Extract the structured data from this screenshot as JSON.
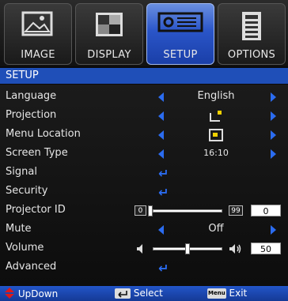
{
  "tabs": [
    {
      "label": "IMAGE",
      "icon": "picture-icon"
    },
    {
      "label": "DISPLAY",
      "icon": "display-icon"
    },
    {
      "label": "SETUP",
      "icon": "setup-icon"
    },
    {
      "label": "OPTIONS",
      "icon": "options-icon"
    }
  ],
  "active_tab": "SETUP",
  "title": "SETUP",
  "menu": {
    "language": {
      "label": "Language",
      "value": "English"
    },
    "projection": {
      "label": "Projection"
    },
    "menu_location": {
      "label": "Menu Location"
    },
    "screen_type": {
      "label": "Screen Type",
      "value": "16:10"
    },
    "signal": {
      "label": "Signal"
    },
    "security": {
      "label": "Security"
    },
    "projector_id": {
      "label": "Projector ID",
      "min": "0",
      "max": "99",
      "value": "0"
    },
    "mute": {
      "label": "Mute",
      "value": "Off"
    },
    "volume": {
      "label": "Volume",
      "value": "50"
    },
    "advanced": {
      "label": "Advanced"
    }
  },
  "footer": {
    "updown": "UpDown",
    "select": "Select",
    "menu_key": "Menu",
    "exit": "Exit"
  },
  "colors": {
    "accent": "#2b6cf0",
    "title_bar": "#1f4fb8",
    "footer": "#1a45b0"
  }
}
